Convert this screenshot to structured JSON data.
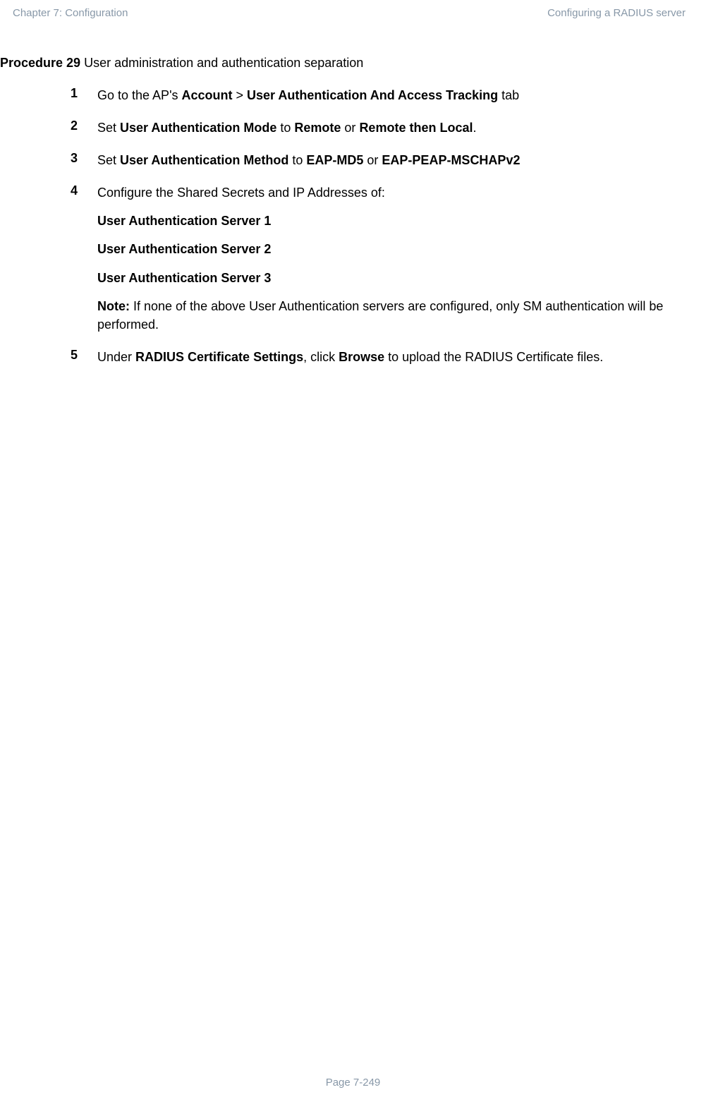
{
  "header": {
    "left": "Chapter 7:  Configuration",
    "right": "Configuring a RADIUS server"
  },
  "procedure": {
    "label": "Procedure 29",
    "title": " User administration and authentication separation"
  },
  "steps": {
    "s1": {
      "num": "1",
      "t1": "Go to the AP's ",
      "b1": "Account",
      "t2": " > ",
      "b2": "User Authentication And Access Tracking",
      "t3": " tab"
    },
    "s2": {
      "num": "2",
      "t1": "Set ",
      "b1": "User Authentication Mode",
      "t2": " to ",
      "b2": "Remote",
      "t3": " or ",
      "b3": "Remote then Local",
      "t4": "."
    },
    "s3": {
      "num": "3",
      "t1": "Set ",
      "b1": "User Authentication Method",
      "t2": " to ",
      "b2": "EAP-MD5",
      "t3": " or ",
      "b3": "EAP-PEAP-MSCHAPv2"
    },
    "s4": {
      "num": "4",
      "p1": "Configure the Shared Secrets and IP Addresses of:",
      "p2": "User Authentication Server 1",
      "p3": "User Authentication Server 2",
      "p4": "User Authentication Server 3",
      "note_label": "Note:",
      "note_text": " If none of the above User Authentication servers are configured, only SM authentication will be performed."
    },
    "s5": {
      "num": "5",
      "t1": "Under ",
      "b1": "RADIUS Certificate Settings",
      "t2": ", click ",
      "b2": "Browse",
      "t3": " to upload the RADIUS Certificate files."
    }
  },
  "footer": "Page 7-249"
}
